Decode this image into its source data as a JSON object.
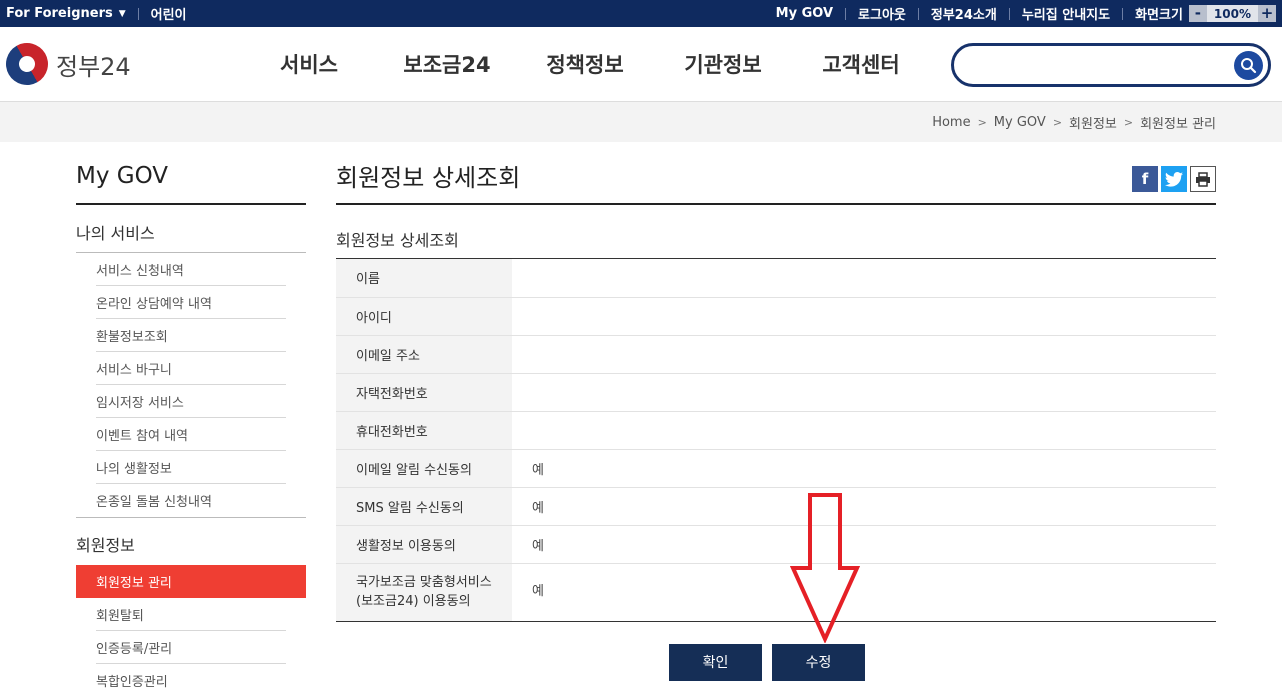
{
  "topbar": {
    "lang": "For Foreigners",
    "kids": "어린이",
    "mygov": "My GOV",
    "logout": "로그아웃",
    "about": "정부24소개",
    "sitemap": "누리집 안내지도",
    "screensize": "화면크기",
    "zoom_minus": "-",
    "zoom_value": "100%",
    "zoom_plus": "+"
  },
  "header": {
    "logo_text": "정부24",
    "nav": [
      "서비스",
      "보조금24",
      "정책정보",
      "기관정보",
      "고객센터"
    ],
    "search_placeholder": ""
  },
  "breadcrumb": [
    "Home",
    "My GOV",
    "회원정보",
    "회원정보 관리"
  ],
  "lnb": {
    "title": "My GOV",
    "group1": "나의 서비스",
    "items1": [
      "서비스 신청내역",
      "온라인 상담예약 내역",
      "환불정보조회",
      "서비스 바구니",
      "임시저장 서비스",
      "이벤트 참여 내역",
      "나의 생활정보",
      "온종일 돌봄 신청내역"
    ],
    "group2": "회원정보",
    "active": "회원정보 관리",
    "items2": [
      "회원탈퇴",
      "인증등록/관리",
      "복합인증관리"
    ]
  },
  "content": {
    "page_title": "회원정보 상세조회",
    "section_title": "회원정보 상세조회",
    "rows": [
      {
        "label": "이름",
        "value": ""
      },
      {
        "label": "아이디",
        "value": ""
      },
      {
        "label": "이메일 주소",
        "value": ""
      },
      {
        "label": "자택전화번호",
        "value": ""
      },
      {
        "label": "휴대전화번호",
        "value": ""
      },
      {
        "label": "이메일 알림 수신동의",
        "value": "예"
      },
      {
        "label": "SMS 알림 수신동의",
        "value": "예"
      },
      {
        "label": "생활정보 이용동의",
        "value": "예"
      }
    ],
    "last_row_label_1": "국가보조금 맞춤형서비스",
    "last_row_label_2": "(보조금24) 이용동의",
    "last_row_value": "예",
    "confirm_button": "확인",
    "edit_button": "수정"
  },
  "colors": {
    "topbar_bg": "#0f2a5f",
    "active_menu": "#ef3e33",
    "button_bg": "#152e56",
    "arrow": "#e52026"
  }
}
